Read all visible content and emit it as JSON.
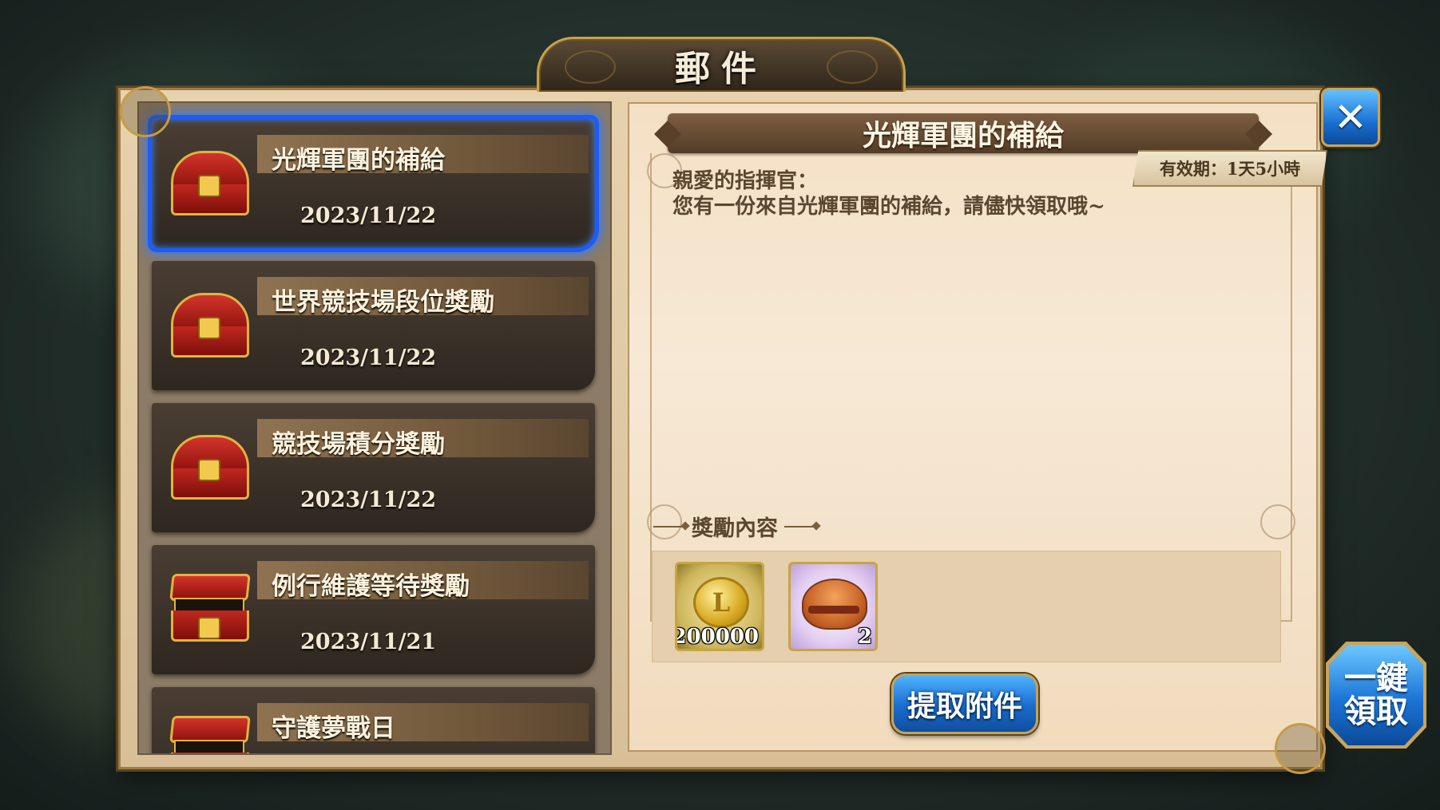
{
  "window": {
    "title": "郵件"
  },
  "mail_list": [
    {
      "title": "光輝軍團的補給",
      "date": "2023/11/22",
      "selected": true,
      "chest": "closed"
    },
    {
      "title": "世界競技場段位獎勵",
      "date": "2023/11/22",
      "selected": false,
      "chest": "closed"
    },
    {
      "title": "競技場積分獎勵",
      "date": "2023/11/22",
      "selected": false,
      "chest": "closed"
    },
    {
      "title": "例行維護等待獎勵",
      "date": "2023/11/21",
      "selected": false,
      "chest": "open"
    },
    {
      "title": "守護夢戰日",
      "date": "",
      "selected": false,
      "chest": "open"
    }
  ],
  "detail": {
    "title": "光輝軍團的補給",
    "expiry": "有效期：1天5小時",
    "greeting": "親愛的指揮官：",
    "body": "您有一份來自光輝軍團的補給，請儘快領取哦~",
    "rewards_label": "獎勵內容",
    "rewards": [
      {
        "icon": "gold-coin-icon",
        "count": "200000",
        "coin_glyph": "L"
      },
      {
        "icon": "burger-icon",
        "count": "2"
      }
    ],
    "claim_button": "提取附件"
  },
  "buttons": {
    "close": "✕",
    "claim_all_line1": "一鍵",
    "claim_all_line2": "領取"
  },
  "colors": {
    "selection": "#1a5cff",
    "button_blue": "#1a6ccd",
    "parchment": "#f4e0c4",
    "gold_trim": "#c9a24a"
  }
}
